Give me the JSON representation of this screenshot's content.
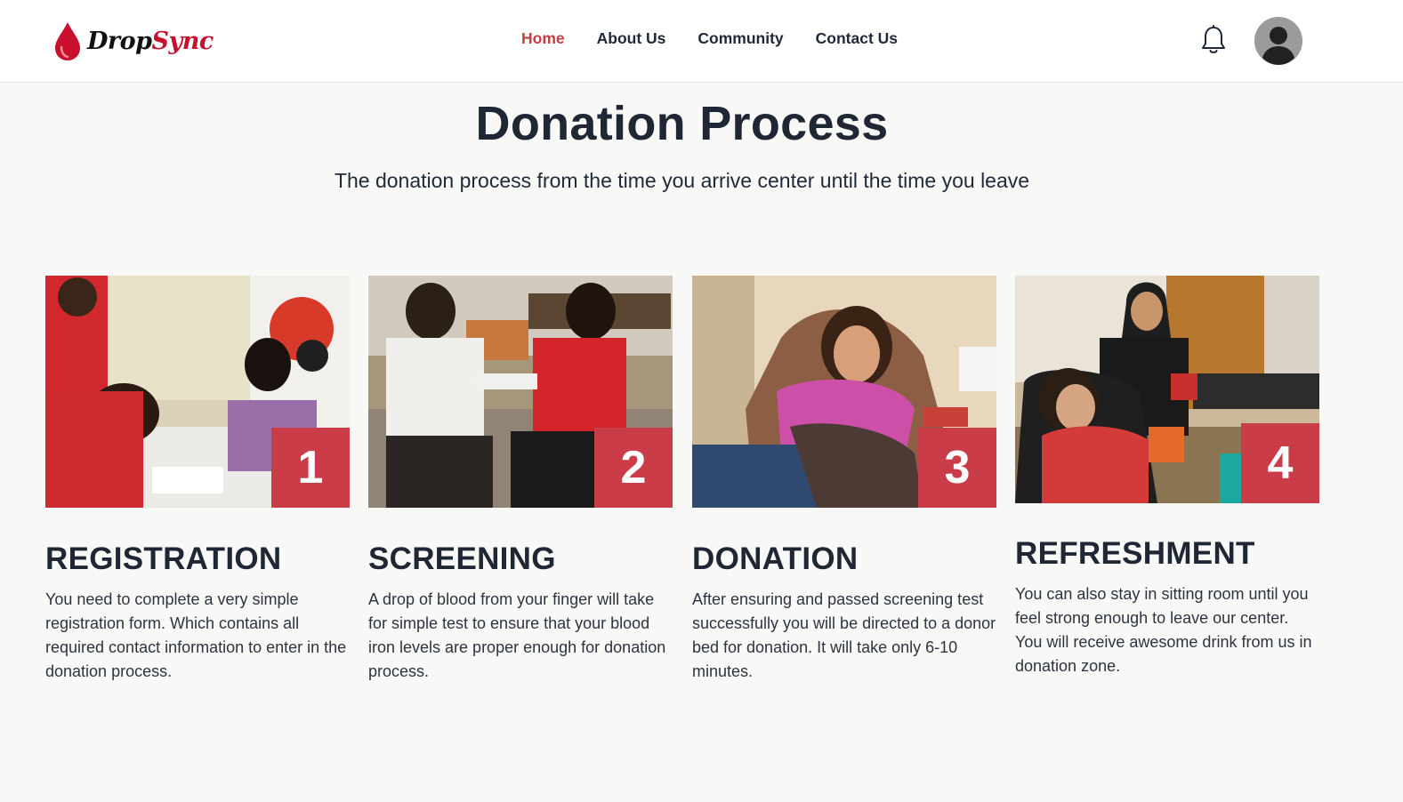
{
  "brand": {
    "name_part1": "Drop",
    "name_part2": "Sync",
    "accent_color": "#c93c44"
  },
  "nav": {
    "links": [
      {
        "label": "Home",
        "active": true
      },
      {
        "label": "About Us",
        "active": false
      },
      {
        "label": "Community",
        "active": false
      },
      {
        "label": "Contact Us",
        "active": false
      }
    ],
    "notification_icon": "bell-icon",
    "profile_icon": "user-avatar-icon"
  },
  "main": {
    "title": "Donation Process",
    "subtitle": "The donation process from the time you arrive center until the time you leave",
    "steps": [
      {
        "number": "1",
        "title": "REGISTRATION",
        "description": "You need to complete a very simple registration form. Which contains all required contact information to enter in the donation process."
      },
      {
        "number": "2",
        "title": "SCREENING",
        "description": "A drop of blood from your finger will take for simple test to ensure that your blood iron levels are proper enough for donation process."
      },
      {
        "number": "3",
        "title": "DONATION",
        "description": "After ensuring and passed screening test successfully you will be directed to a donor bed for donation. It will take only 6-10 minutes."
      },
      {
        "number": "4",
        "title": "REFRESHMENT",
        "description": "You can also stay in sitting room until you feel strong enough to leave our center. You will receive awesome drink from us in donation zone."
      }
    ],
    "step_badge_color": "#c93c48"
  }
}
